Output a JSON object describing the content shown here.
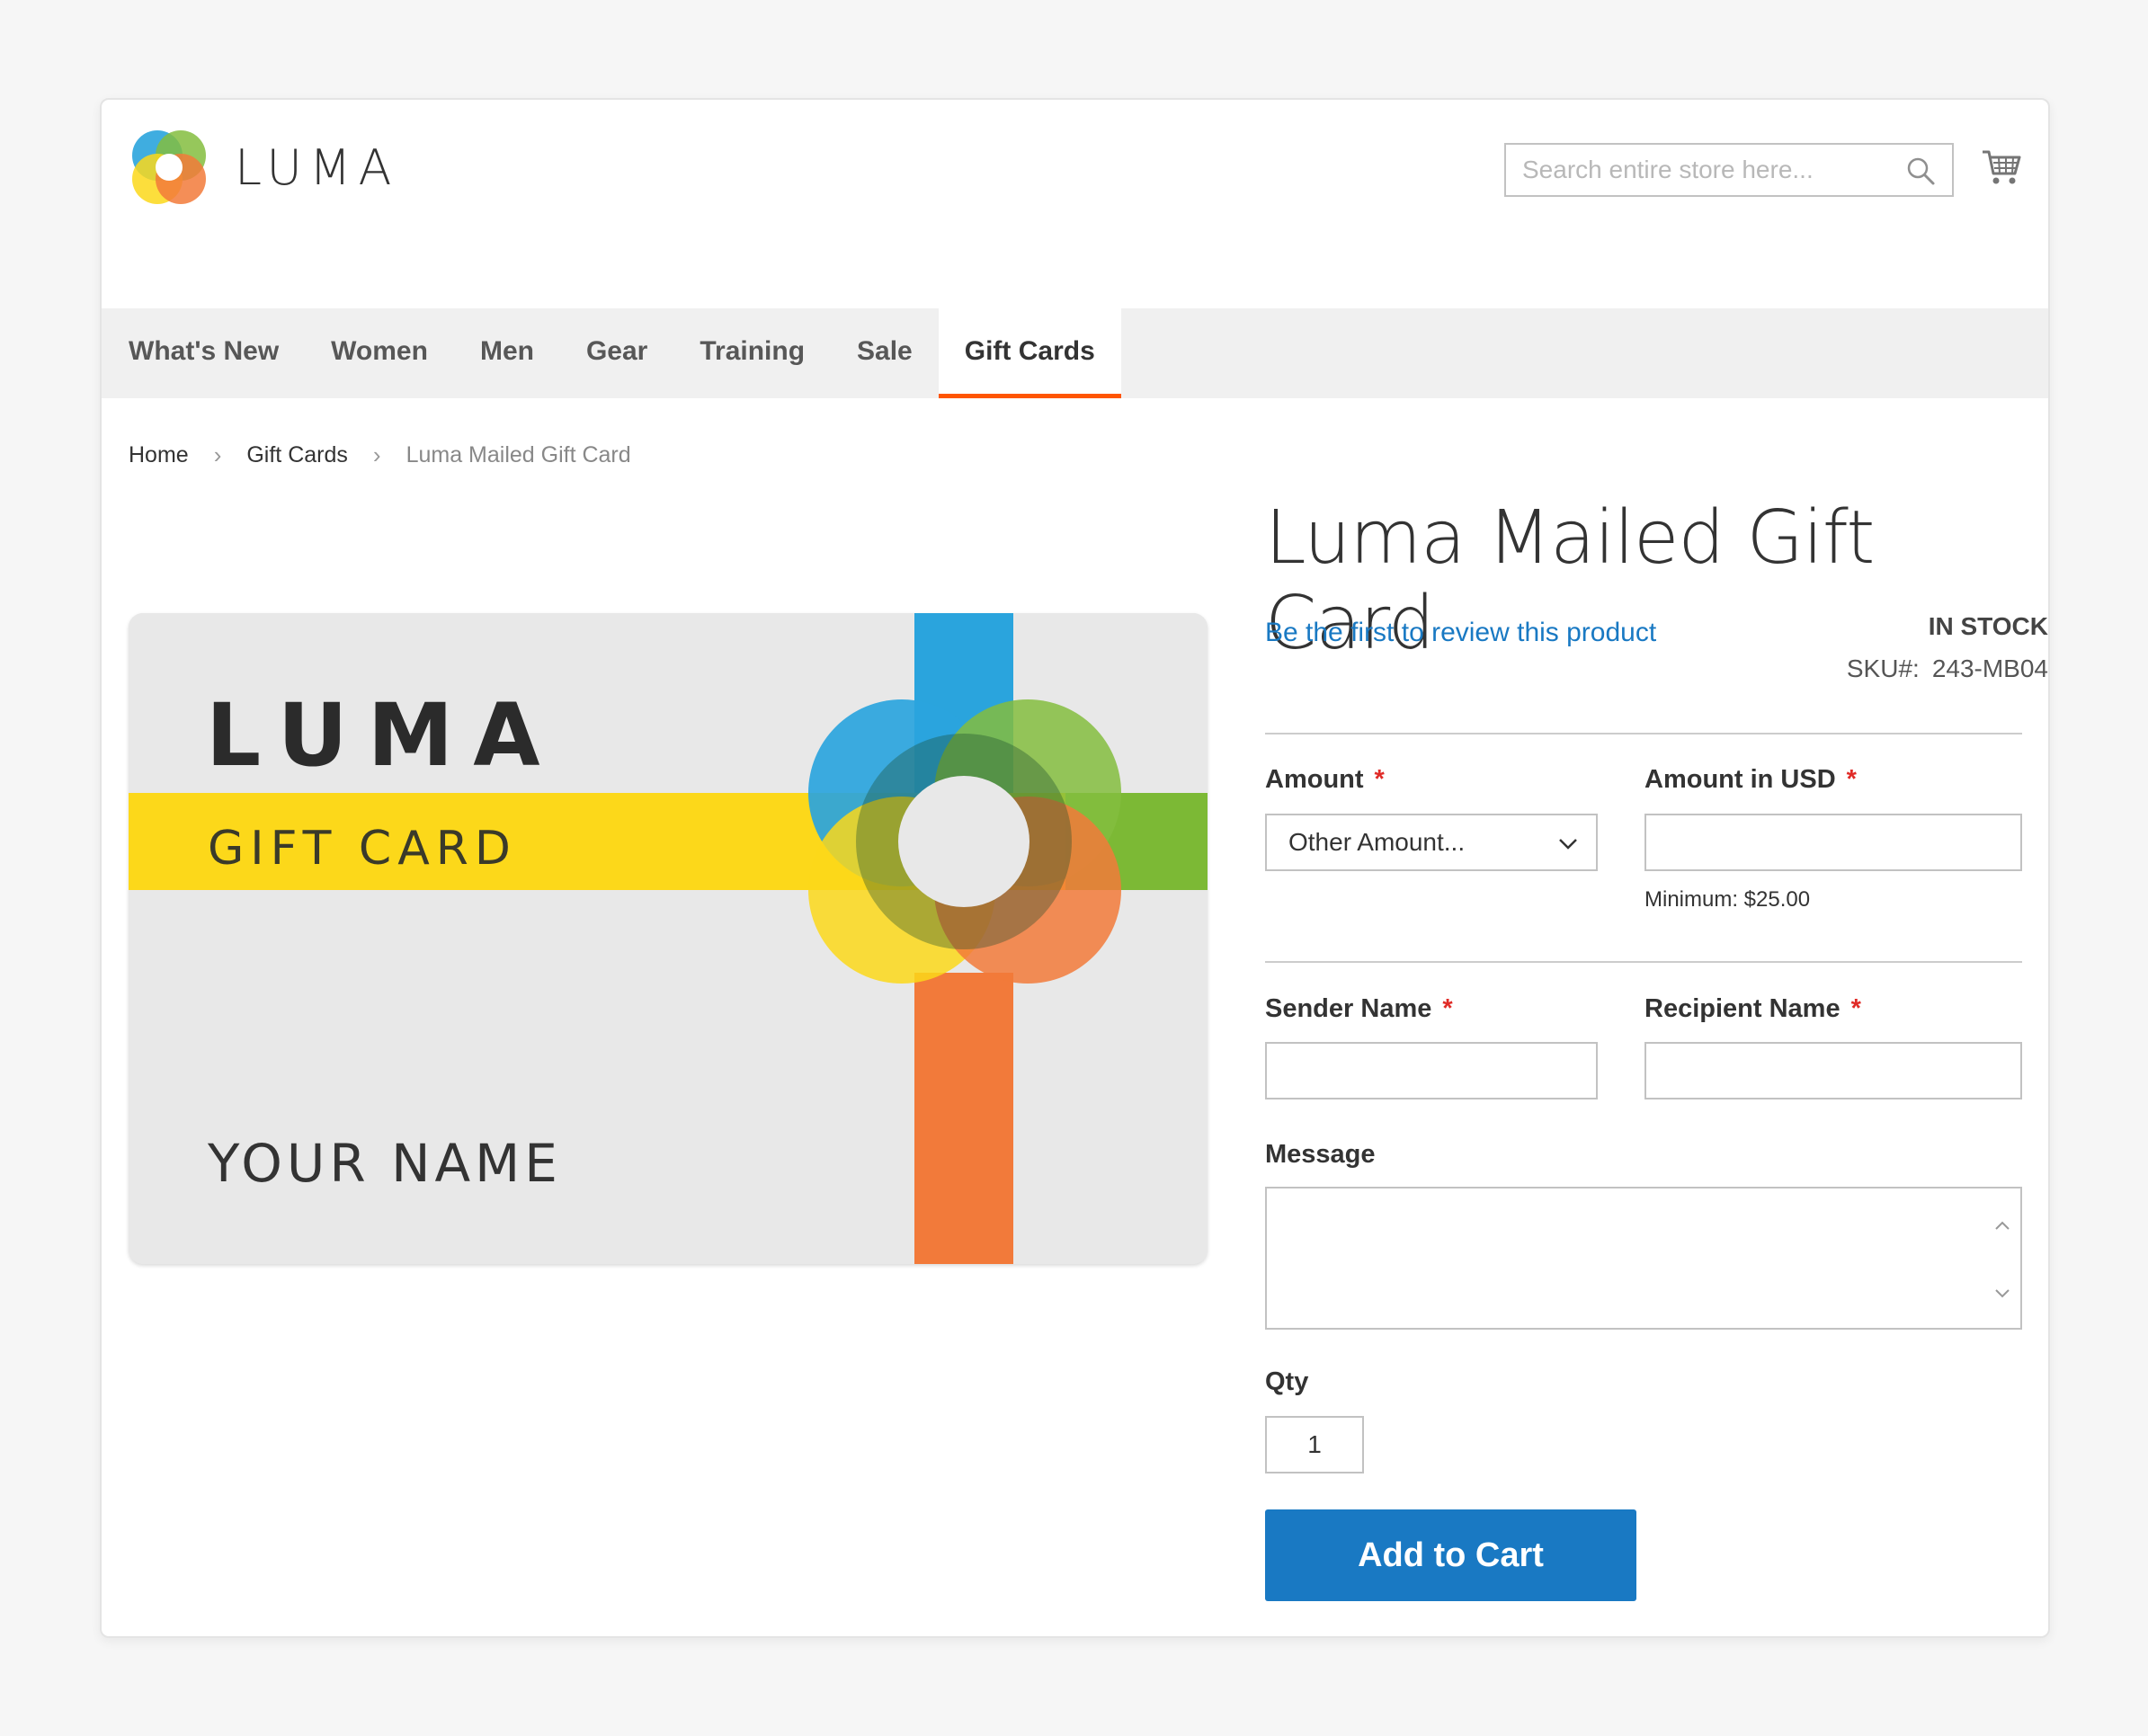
{
  "brand": {
    "name": "LUMA",
    "accent": "#ff5501",
    "link_color": "#1979c3"
  },
  "search": {
    "placeholder": "Search entire store here...",
    "value": ""
  },
  "nav": {
    "items": [
      {
        "label": "What's New",
        "active": false
      },
      {
        "label": "Women",
        "active": false
      },
      {
        "label": "Men",
        "active": false
      },
      {
        "label": "Gear",
        "active": false
      },
      {
        "label": "Training",
        "active": false
      },
      {
        "label": "Sale",
        "active": false
      },
      {
        "label": "Gift Cards",
        "active": true
      }
    ]
  },
  "breadcrumb": {
    "items": [
      "Home",
      "Gift Cards"
    ],
    "current": "Luma Mailed Gift Card",
    "separator": ">"
  },
  "product_image": {
    "brand": "LUMA",
    "subtitle": "GIFT CARD",
    "name": "YOUR NAME"
  },
  "product": {
    "title": "Luma Mailed Gift Card",
    "review_link": "Be the first to review this product",
    "stock": "IN STOCK",
    "sku_label": "SKU#:",
    "sku": "243-MB04"
  },
  "form": {
    "required_mark": "*",
    "amount_label": "Amount",
    "amount_value": "Other Amount...",
    "amount_usd_label": "Amount in USD",
    "amount_usd_value": "",
    "minimum_note": "Minimum: $25.00",
    "sender_label": "Sender Name",
    "sender_value": "",
    "recipient_label": "Recipient Name",
    "recipient_value": "",
    "message_label": "Message",
    "message_value": "",
    "qty_label": "Qty",
    "qty_value": "1",
    "add_to_cart": "Add to Cart"
  },
  "icons": {
    "search": "search-icon",
    "cart": "cart-icon",
    "chevron": "chevron-down-icon",
    "breadcrumb_sep": "chevron-right-icon"
  }
}
